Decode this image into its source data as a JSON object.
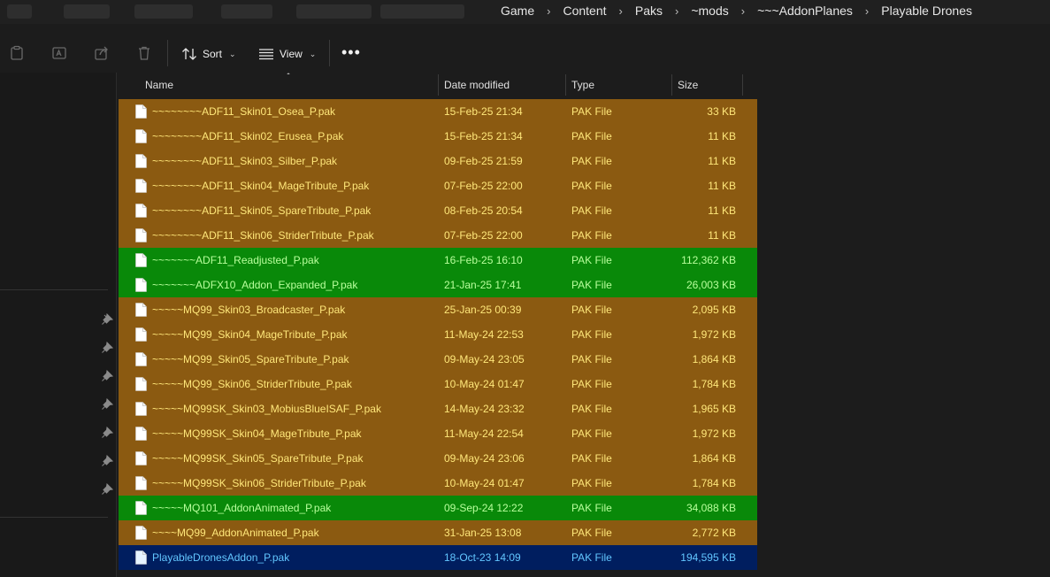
{
  "breadcrumb": [
    "Game",
    "Content",
    "Paks",
    "~mods",
    "~~~AddonPlanes",
    "Playable Drones"
  ],
  "toolbar": {
    "sort_label": "Sort",
    "view_label": "View"
  },
  "columns": {
    "name": "Name",
    "date": "Date modified",
    "type": "Type",
    "size": "Size"
  },
  "colors": {
    "orange": "#8b5a11",
    "green": "#098909",
    "selected": "#001e5f"
  },
  "files": [
    {
      "name": "~~~~~~~~ADF11_Skin01_Osea_P.pak",
      "date": "15-Feb-25 21:34",
      "type": "PAK File",
      "size": "33 KB",
      "style": "orange"
    },
    {
      "name": "~~~~~~~~ADF11_Skin02_Erusea_P.pak",
      "date": "15-Feb-25 21:34",
      "type": "PAK File",
      "size": "11 KB",
      "style": "orange"
    },
    {
      "name": "~~~~~~~~ADF11_Skin03_Silber_P.pak",
      "date": "09-Feb-25 21:59",
      "type": "PAK File",
      "size": "11 KB",
      "style": "orange"
    },
    {
      "name": "~~~~~~~~ADF11_Skin04_MageTribute_P.pak",
      "date": "07-Feb-25 22:00",
      "type": "PAK File",
      "size": "11 KB",
      "style": "orange"
    },
    {
      "name": "~~~~~~~~ADF11_Skin05_SpareTribute_P.pak",
      "date": "08-Feb-25 20:54",
      "type": "PAK File",
      "size": "11 KB",
      "style": "orange"
    },
    {
      "name": "~~~~~~~~ADF11_Skin06_StriderTribute_P.pak",
      "date": "07-Feb-25 22:00",
      "type": "PAK File",
      "size": "11 KB",
      "style": "orange"
    },
    {
      "name": "~~~~~~~ADF11_Readjusted_P.pak",
      "date": "16-Feb-25 16:10",
      "type": "PAK File",
      "size": "112,362 KB",
      "style": "green"
    },
    {
      "name": "~~~~~~~ADFX10_Addon_Expanded_P.pak",
      "date": "21-Jan-25 17:41",
      "type": "PAK File",
      "size": "26,003 KB",
      "style": "green"
    },
    {
      "name": "~~~~~MQ99_Skin03_Broadcaster_P.pak",
      "date": "25-Jan-25 00:39",
      "type": "PAK File",
      "size": "2,095 KB",
      "style": "orange"
    },
    {
      "name": "~~~~~MQ99_Skin04_MageTribute_P.pak",
      "date": "11-May-24 22:53",
      "type": "PAK File",
      "size": "1,972 KB",
      "style": "orange"
    },
    {
      "name": "~~~~~MQ99_Skin05_SpareTribute_P.pak",
      "date": "09-May-24 23:05",
      "type": "PAK File",
      "size": "1,864 KB",
      "style": "orange"
    },
    {
      "name": "~~~~~MQ99_Skin06_StriderTribute_P.pak",
      "date": "10-May-24 01:47",
      "type": "PAK File",
      "size": "1,784 KB",
      "style": "orange"
    },
    {
      "name": "~~~~~MQ99SK_Skin03_MobiusBlueISAF_P.pak",
      "date": "14-May-24 23:32",
      "type": "PAK File",
      "size": "1,965 KB",
      "style": "orange"
    },
    {
      "name": "~~~~~MQ99SK_Skin04_MageTribute_P.pak",
      "date": "11-May-24 22:54",
      "type": "PAK File",
      "size": "1,972 KB",
      "style": "orange"
    },
    {
      "name": "~~~~~MQ99SK_Skin05_SpareTribute_P.pak",
      "date": "09-May-24 23:06",
      "type": "PAK File",
      "size": "1,864 KB",
      "style": "orange"
    },
    {
      "name": "~~~~~MQ99SK_Skin06_StriderTribute_P.pak",
      "date": "10-May-24 01:47",
      "type": "PAK File",
      "size": "1,784 KB",
      "style": "orange"
    },
    {
      "name": "~~~~~MQ101_AddonAnimated_P.pak",
      "date": "09-Sep-24 12:22",
      "type": "PAK File",
      "size": "34,088 KB",
      "style": "green"
    },
    {
      "name": "~~~~MQ99_AddonAnimated_P.pak",
      "date": "31-Jan-25 13:08",
      "type": "PAK File",
      "size": "2,772 KB",
      "style": "orange"
    },
    {
      "name": "PlayableDronesAddon_P.pak",
      "date": "18-Oct-23 14:09",
      "type": "PAK File",
      "size": "194,595 KB",
      "style": "selected"
    }
  ]
}
